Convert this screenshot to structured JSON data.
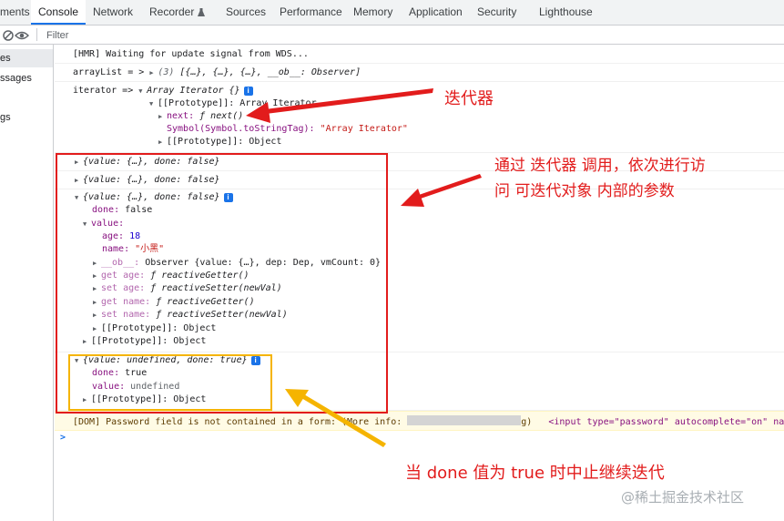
{
  "tabs": [
    {
      "label": "ments",
      "active": false
    },
    {
      "label": "Console",
      "active": true
    },
    {
      "label": "Network",
      "active": false
    },
    {
      "label": "Recorder",
      "active": false
    },
    {
      "label": "Sources",
      "active": false
    },
    {
      "label": "Performance",
      "active": false
    },
    {
      "label": "Memory",
      "active": false
    },
    {
      "label": "Application",
      "active": false
    },
    {
      "label": "Security",
      "active": false
    },
    {
      "label": "Lighthouse",
      "active": false
    }
  ],
  "toolbar": {
    "filter_placeholder": "Filter",
    "icons": [
      "block-icon",
      "eye-icon"
    ]
  },
  "sidebar": {
    "items": [
      {
        "label": "es",
        "selected": true
      },
      {
        "label": "ssages",
        "selected": false
      },
      {
        "label": "gs",
        "selected": false
      }
    ]
  },
  "console": {
    "hmr": "[HMR] Waiting for update signal from WDS...",
    "arraylist": {
      "prefix": "arrayList = ",
      "arrow": ">",
      "count": "(3)",
      "body": "[{…}, {…}, {…}, __ob__: Observer]"
    },
    "iterator": {
      "prefix": "iterator => ",
      "title": "Array Iterator {}",
      "proto_line": "[[Prototype]]: Array Iterator",
      "next_key": "next:",
      "next_val": "ƒ next()",
      "symbol_key": "Symbol(Symbol.toStringTag):",
      "symbol_val": "\"Array Iterator\"",
      "proto2": "[[Prototype]]: Object"
    },
    "result1": "{value: {…}, done: false}",
    "result2": "{value: {…}, done: false}",
    "result3": {
      "summary": "{value: {…}, done: false}",
      "done_key": "done:",
      "done_val": "false",
      "value_key": "value:",
      "age_key": "age:",
      "age_val": "18",
      "name_key": "name:",
      "name_val": "\"小黑\"",
      "ob_key": "__ob__:",
      "ob_val": "Observer {value: {…}, dep: Dep, vmCount: 0}",
      "get_age_key": "get age:",
      "get_age_val": "ƒ reactiveGetter()",
      "set_age_key": "set age:",
      "set_age_val": "ƒ reactiveSetter(newVal)",
      "get_name_key": "get name:",
      "get_name_val": "ƒ reactiveGetter()",
      "set_name_key": "set name:",
      "set_name_val": "ƒ reactiveSetter(newVal)",
      "value_proto": "[[Prototype]]: Object",
      "proto": "[[Prototype]]: Object"
    },
    "result4": {
      "summary": "{value: undefined, done: true}",
      "done_key": "done:",
      "done_val": "true",
      "value_key": "value:",
      "value_val": "undefined",
      "proto": "[[Prototype]]: Object"
    },
    "warning": {
      "text": "[DOM] Password field is not contained in a form: (More info:",
      "tail": "g)",
      "tag": "<input type=\"password\" autocomplete=\"on\" name="
    },
    "prompt": ">"
  },
  "annotations": {
    "label_iterator": "迭代器",
    "label_access_line1": "通过 迭代器 调用，依次进行访",
    "label_access_line2": "问 可迭代对象 内部的参数",
    "label_done": "当 done 值为 true 时中止继续迭代",
    "red_color": "#e21c1c",
    "orange_color": "#f5b400"
  },
  "watermark": "@稀土掘金技术社区"
}
